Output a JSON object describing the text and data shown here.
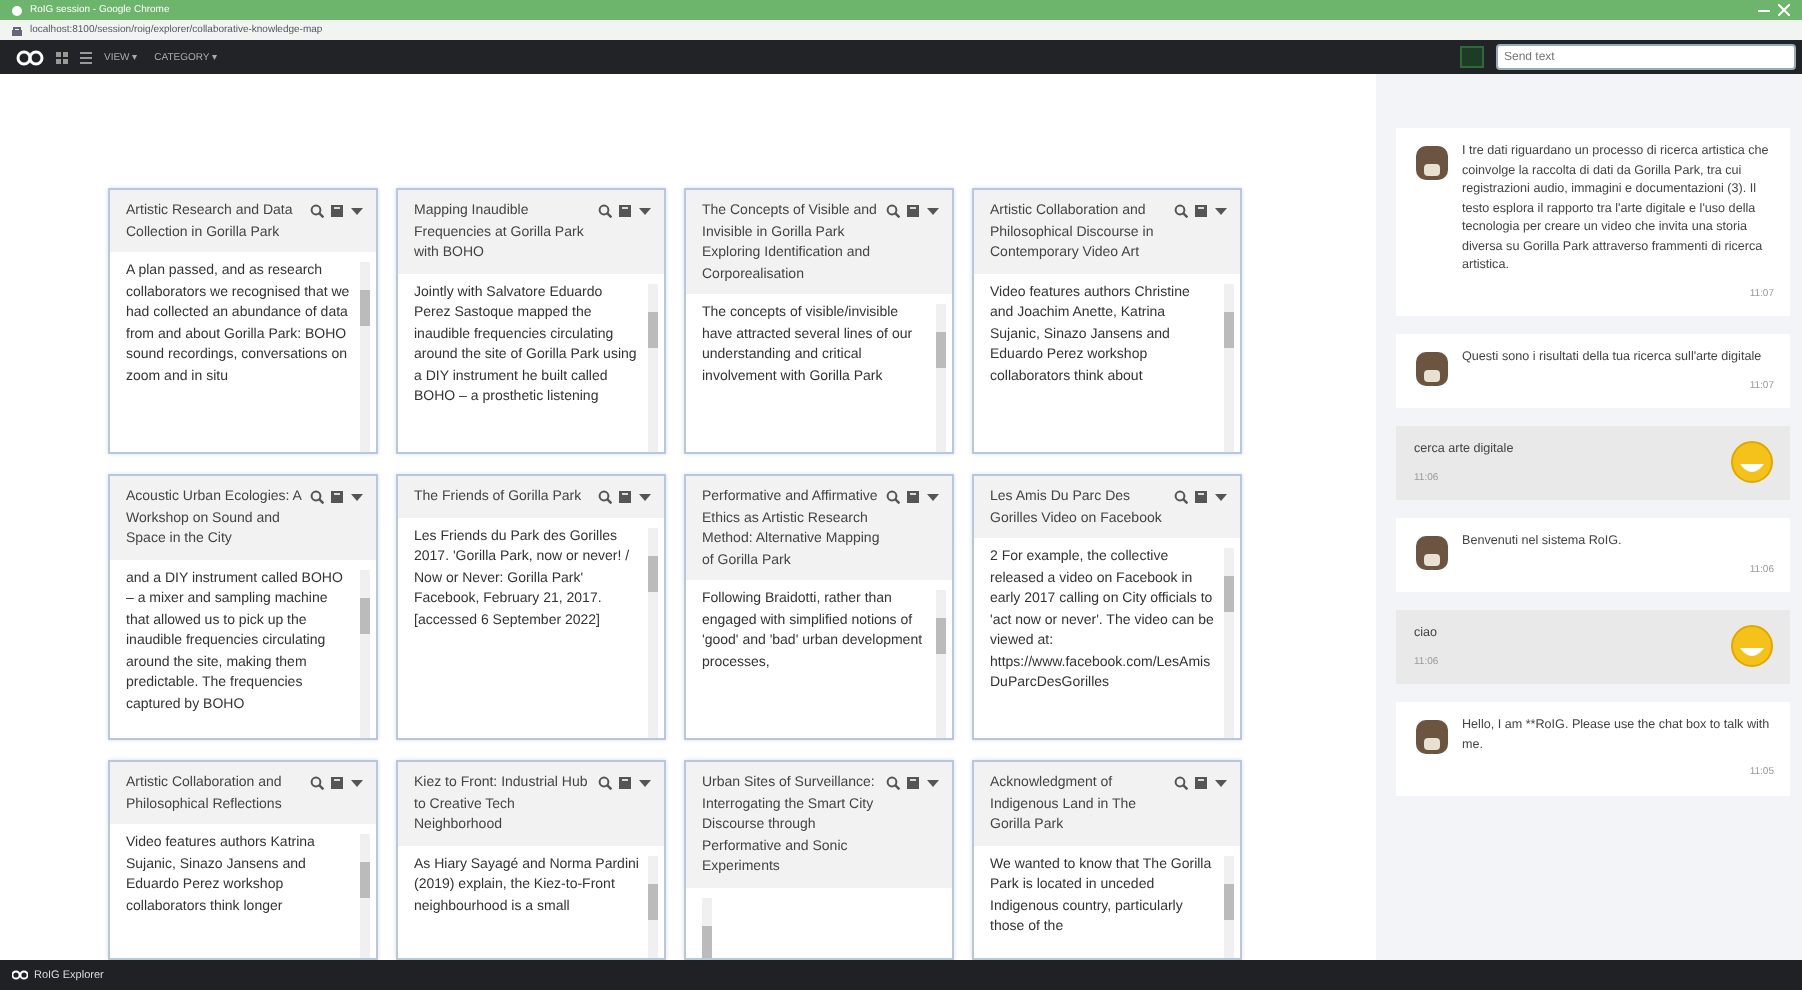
{
  "browser": {
    "title": "RoIG session - Google Chrome",
    "address": "localhost:8100/session/roig/explorer/collaborative-knowledge-map"
  },
  "nav": {
    "menus": [
      {
        "label": "VIEW ▾"
      },
      {
        "label": "CATEGORY ▾"
      }
    ],
    "search": {
      "placeholder": "Send text"
    }
  },
  "cards": [
    {
      "title": "Artistic Research and Data Collection in Gorilla Park",
      "body": "A plan passed, and as research collaborators we recognised that we had collected an abundance of data from and about Gorilla Park: BOHO sound recordings, conversations on zoom and in situ"
    },
    {
      "title": "Mapping Inaudible Frequencies at Gorilla Park with BOHO",
      "body": "Jointly with Salvatore Eduardo Perez Sastoque mapped the inaudible frequencies circulating around the site of Gorilla Park using a DIY instrument he built called BOHO – a prosthetic listening"
    },
    {
      "title": "The Concepts of Visible and Invisible in Gorilla Park Exploring Identification and Corporealisation",
      "body": "The concepts of visible/invisible have attracted several lines of our understanding and critical involvement with Gorilla Park"
    },
    {
      "title": "Artistic Collaboration and Philosophical Discourse in Contemporary Video Art",
      "body": "Video features authors Christine and Joachim Anette, Katrina Sujanic, Sinazo Jansens and Eduardo Perez workshop collaborators think about"
    },
    {
      "title": "Acoustic Urban Ecologies: A Workshop on Sound and Space in the City",
      "body": "and a DIY instrument called BOHO – a mixer and sampling machine that allowed us to pick up the inaudible frequencies circulating around the site, making them predictable. The frequencies captured by BOHO"
    },
    {
      "title": "The Friends of Gorilla Park",
      "body": "Les Friends du Park des Gorilles 2017. 'Gorilla Park, now or never! / Now or Never: Gorilla Park' Facebook, February 21, 2017. [accessed 6 September 2022]"
    },
    {
      "title": "Performative and Affirmative Ethics as Artistic Research Method: Alternative Mapping of Gorilla Park",
      "body": "Following Braidotti, rather than engaged with simplified notions of 'good' and 'bad' urban development processes,"
    },
    {
      "title": "Les Amis Du Parc Des Gorilles Video on Facebook",
      "body": "2 For example, the collective released a video on Facebook in early 2017 calling on City officials to 'act now or never'. The video can be viewed at: https://www.facebook.com/LesAmisDuParcDesGorilles"
    },
    {
      "title": "Artistic Collaboration and Philosophical Reflections",
      "body": "Video features authors Katrina Sujanic, Sinazo Jansens and Eduardo Perez workshop collaborators think longer"
    },
    {
      "title": "Kiez to Front: Industrial Hub to Creative Tech Neighborhood",
      "body": "As Hiary Sayagé and Norma Pardini (2019) explain, the Kiez-to-Front neighbourhood is a small"
    },
    {
      "title": "Urban Sites of Surveillance: Interrogating the Smart City Discourse through Performative and Sonic Experiments"
    },
    {
      "title": "Acknowledgment of Indigenous Land in The Gorilla Park",
      "body": "We wanted to know that The Gorilla Park is located in unceded Indigenous country, particularly those of the"
    }
  ],
  "chat": [
    {
      "kind": "bot",
      "text": "I tre dati riguardano un processo di ricerca artistica che coinvolge la raccolta di dati da Gorilla Park, tra cui registrazioni audio, immagini e documentazioni (3). Il testo esplora il rapporto tra l'arte digitale e l'uso della tecnologia per creare un video che invita una storia diversa su Gorilla Park attraverso frammenti di ricerca artistica.",
      "time": "11:07"
    },
    {
      "kind": "bot",
      "text": "Questi sono i risultati della tua ricerca sull'arte digitale",
      "time": "11:07"
    },
    {
      "kind": "user",
      "text": "cerca arte digitale",
      "time": "11:06"
    },
    {
      "kind": "bot",
      "text": "Benvenuti nel sistema RoIG.",
      "time": "11:06"
    },
    {
      "kind": "user",
      "text": "ciao",
      "time": "11:06"
    },
    {
      "kind": "bot",
      "text": "Hello, I am **RoIG. Please use the chat box to talk with me.",
      "time": "11:05"
    }
  ],
  "taskbar": {
    "label": "RoIG Explorer"
  }
}
